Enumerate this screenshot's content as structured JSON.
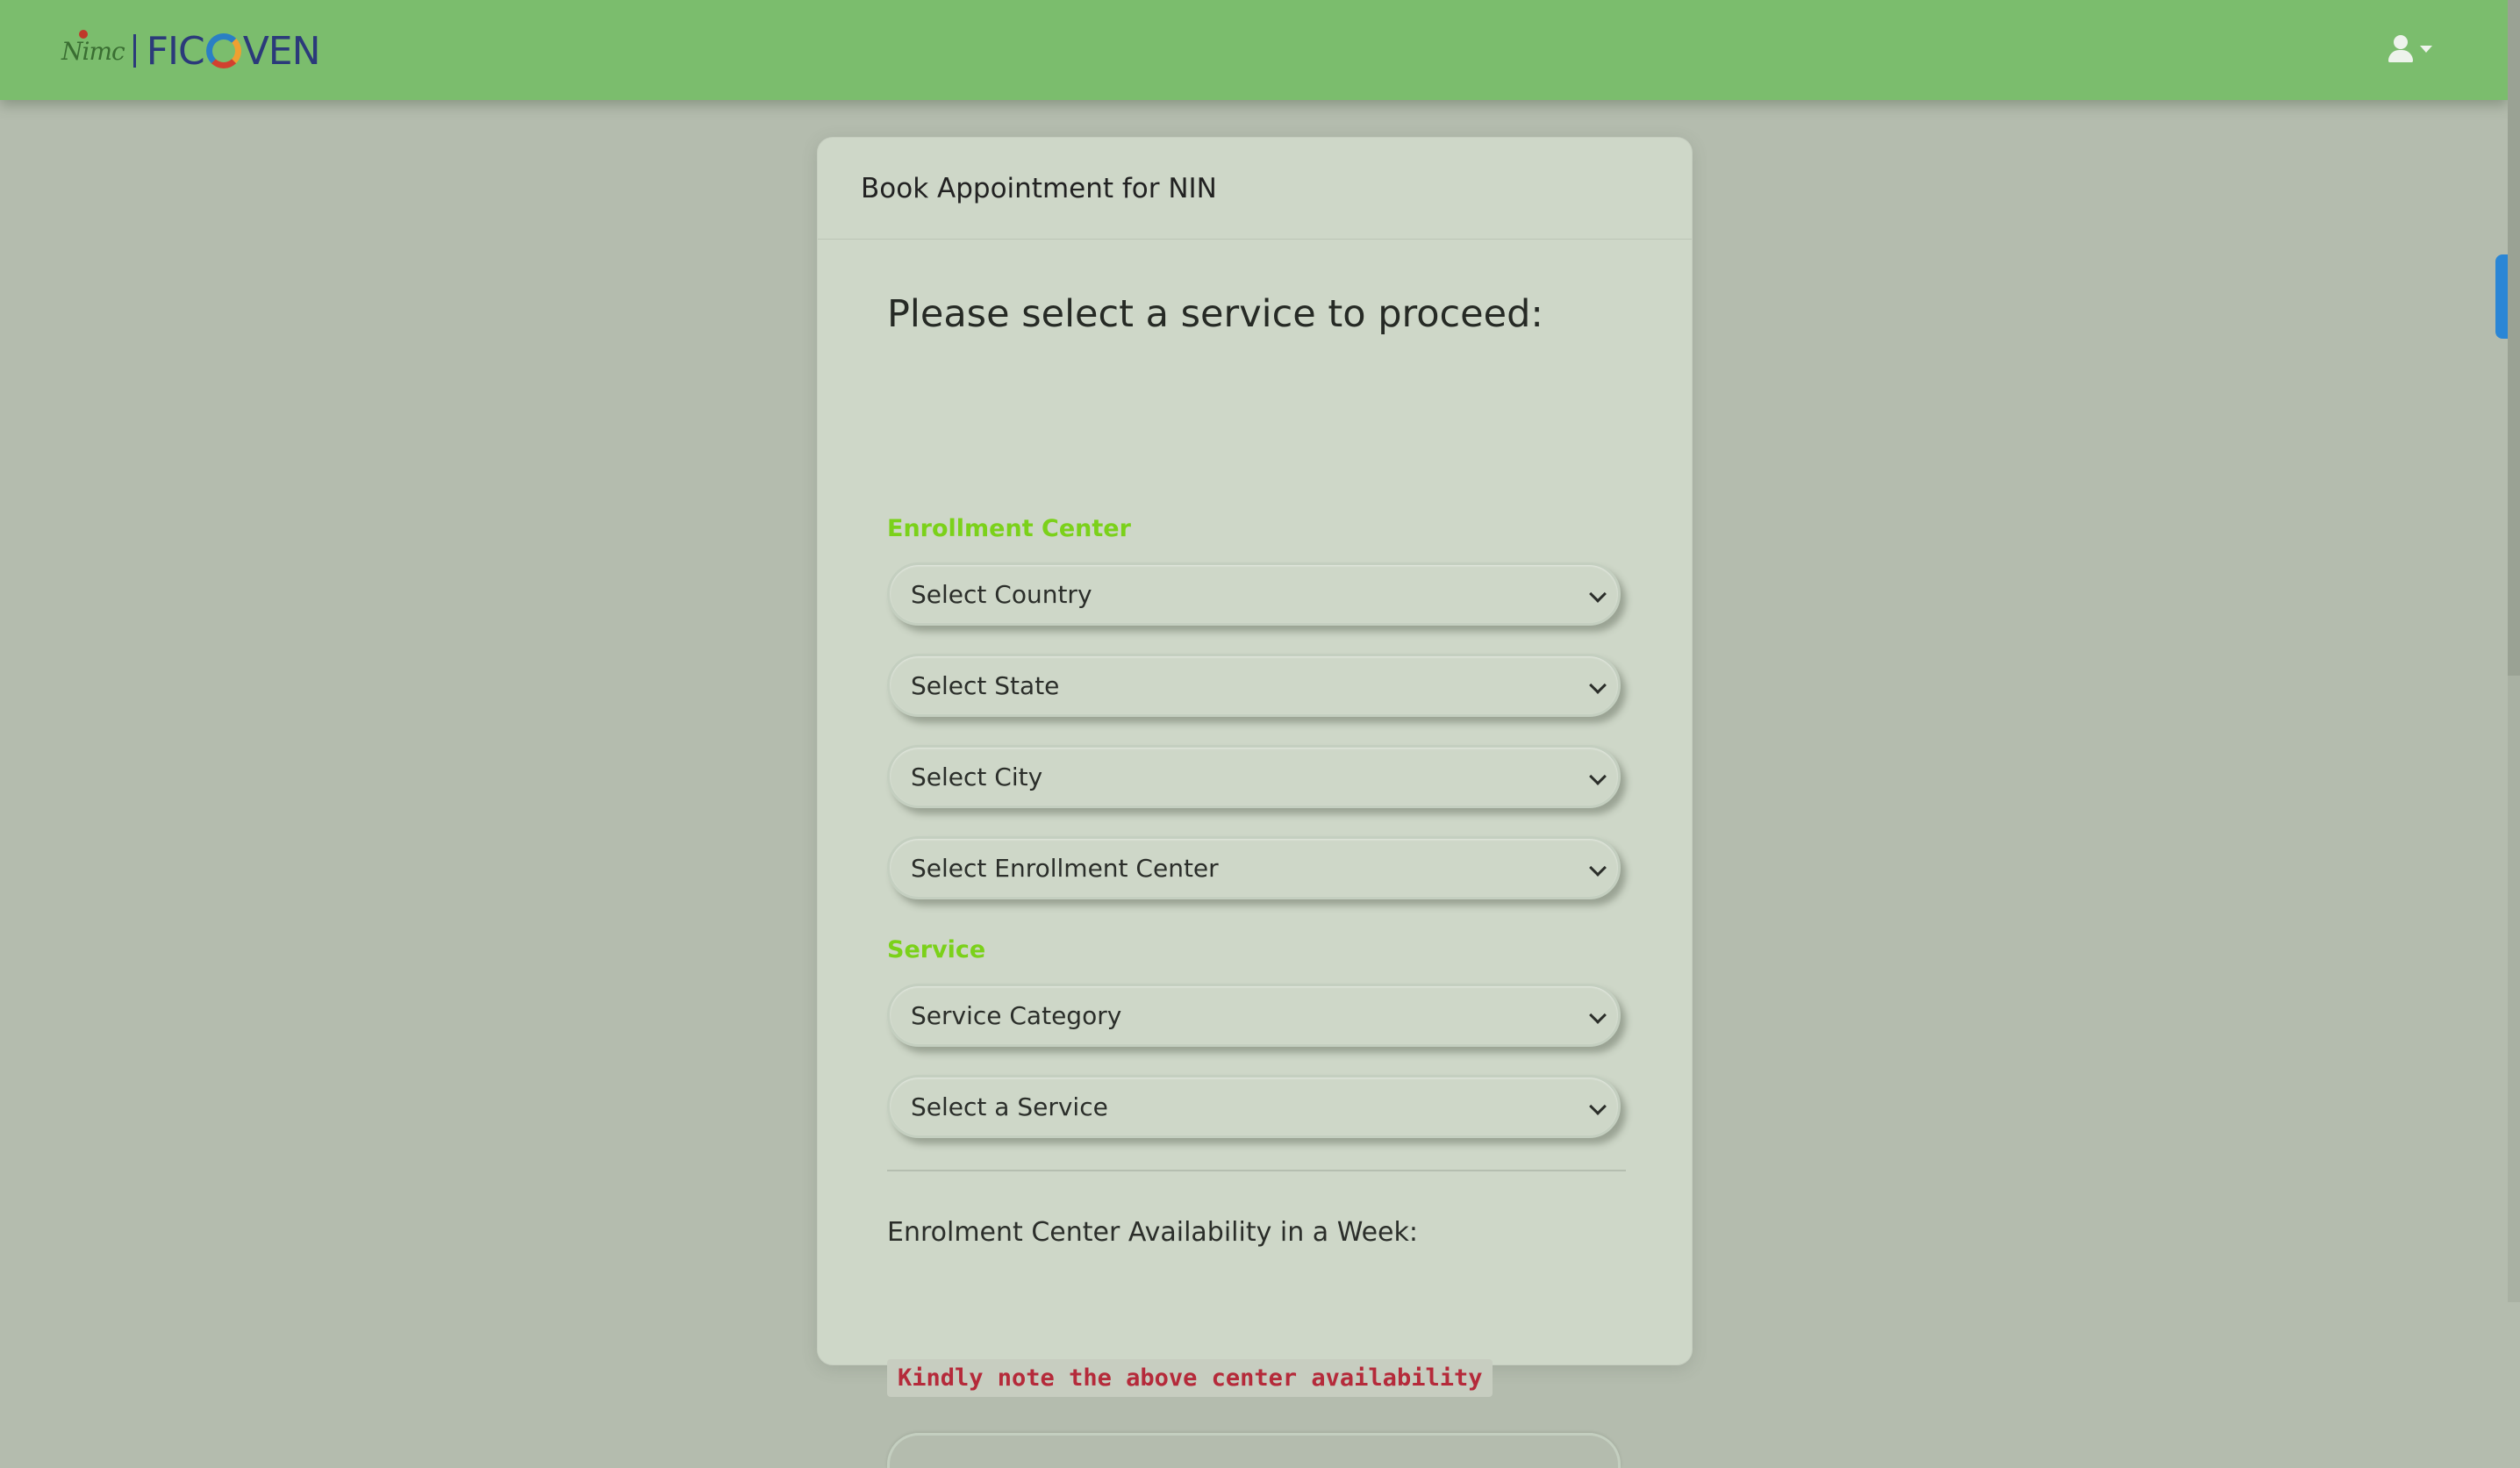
{
  "navbar": {
    "brand_seal": "Nimc",
    "brand_left": "FIC",
    "brand_right": "VEN"
  },
  "card": {
    "title": "Book Appointment for NIN",
    "heading": "Please select a service to proceed:",
    "enrollment_group": {
      "label": "Enrollment Center",
      "selects": [
        "Select Country",
        "Select State",
        "Select City",
        "Select Enrollment Center"
      ]
    },
    "service_group": {
      "label": "Service",
      "selects": [
        "Service Category",
        "Select a Service"
      ]
    },
    "availability_label": "Enrolment Center Availability in a Week:",
    "note": "Kindly note the above center availability"
  },
  "icons": {
    "user": "user-icon",
    "caret": "caret-down-icon",
    "select_arrow": "chevron-down-icon"
  },
  "colors": {
    "navbar": "#7bbd6d",
    "accent_green": "#7bd11a",
    "note_red": "#b52a3a",
    "scroll_indicator": "#2a86d6"
  }
}
